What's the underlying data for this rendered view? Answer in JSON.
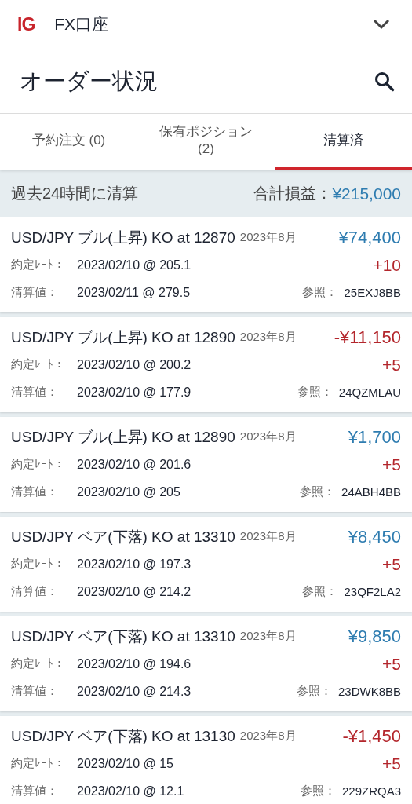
{
  "header": {
    "logo": "IG",
    "account": "FX口座"
  },
  "page": {
    "title": "オーダー状況"
  },
  "tabs": [
    {
      "label": "予約注文 (0)",
      "selected": false
    },
    {
      "label": "保有ポジション (2)",
      "selected": false
    },
    {
      "label": "清算済",
      "selected": true
    }
  ],
  "summary": {
    "label": "過去24時間に清算",
    "total_label": "合計損益：",
    "total": "¥215,000"
  },
  "trades": [
    {
      "title": "USD/JPY ブル(上昇) KO at 12870",
      "expiry": "2023年8月",
      "pnl": "¥74,400",
      "color": "#2e7cb0",
      "rate_label": "約定ﾚｰﾄ：",
      "rate": "2023/02/10 @ 205.1",
      "quantity": "+10",
      "close_label": "清算値：",
      "close": "2023/02/11 @ 279.5",
      "ref_label": "参照：",
      "ref": "25EXJ8BB"
    },
    {
      "title": "USD/JPY ブル(上昇) KO at 12890",
      "expiry": "2023年8月",
      "pnl": "-¥11,150",
      "color": "#b3262c",
      "rate_label": "約定ﾚｰﾄ：",
      "rate": "2023/02/10 @ 200.2",
      "quantity": "+5",
      "close_label": "清算値：",
      "close": "2023/02/10 @ 177.9",
      "ref_label": "参照：",
      "ref": "24QZMLAU"
    },
    {
      "title": "USD/JPY ブル(上昇) KO at 12890",
      "expiry": "2023年8月",
      "pnl": "¥1,700",
      "color": "#2e7cb0",
      "rate_label": "約定ﾚｰﾄ：",
      "rate": "2023/02/10 @ 201.6",
      "quantity": "+5",
      "close_label": "清算値：",
      "close": "2023/02/10 @ 205",
      "ref_label": "参照：",
      "ref": "24ABH4BB"
    },
    {
      "title": "USD/JPY ベア(下落) KO at 13310",
      "expiry": "2023年8月",
      "pnl": "¥8,450",
      "color": "#2e7cb0",
      "rate_label": "約定ﾚｰﾄ：",
      "rate": "2023/02/10 @ 197.3",
      "quantity": "+5",
      "close_label": "清算値：",
      "close": "2023/02/10 @ 214.2",
      "ref_label": "参照：",
      "ref": "23QF2LA2"
    },
    {
      "title": "USD/JPY ベア(下落) KO at 13310",
      "expiry": "2023年8月",
      "pnl": "¥9,850",
      "color": "#2e7cb0",
      "rate_label": "約定ﾚｰﾄ：",
      "rate": "2023/02/10 @ 194.6",
      "quantity": "+5",
      "close_label": "清算値：",
      "close": "2023/02/10 @ 214.3",
      "ref_label": "参照：",
      "ref": "23DWK8BB"
    },
    {
      "title": "USD/JPY ベア(下落) KO at 13130",
      "expiry": "2023年8月",
      "pnl": "-¥1,450",
      "color": "#b3262c",
      "rate_label": "約定ﾚｰﾄ：",
      "rate": "2023/02/10 @ 15",
      "quantity": "+5",
      "close_label": "清算値：",
      "close": "2023/02/10 @ 12.1",
      "ref_label": "参照：",
      "ref": "229ZRQA3"
    }
  ]
}
